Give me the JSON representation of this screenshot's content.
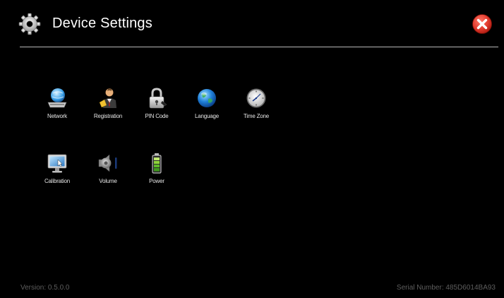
{
  "header": {
    "title": "Device Settings",
    "settings_icon": "gear-icon",
    "close_icon": "close-icon"
  },
  "tiles": {
    "network": {
      "label": "Network",
      "icon": "network-icon"
    },
    "registration": {
      "label": "Registration",
      "icon": "registration-icon"
    },
    "pin_code": {
      "label": "PIN Code",
      "icon": "lock-icon"
    },
    "language": {
      "label": "Language",
      "icon": "globe-icon"
    },
    "time_zone": {
      "label": "Time Zone",
      "icon": "clock-icon"
    },
    "calibration": {
      "label": "Calibration",
      "icon": "monitor-icon"
    },
    "volume": {
      "label": "Volume",
      "icon": "speaker-icon"
    },
    "power": {
      "label": "Power",
      "icon": "battery-icon"
    }
  },
  "footer": {
    "version": "Version: 0.5.0.0",
    "serial_number": "Serial Number: 485D6014BA93"
  },
  "colors": {
    "background": "#000000",
    "title_text": "#ffffff",
    "close_red": "#e23b2e",
    "footer_text": "#5e5e5e"
  }
}
